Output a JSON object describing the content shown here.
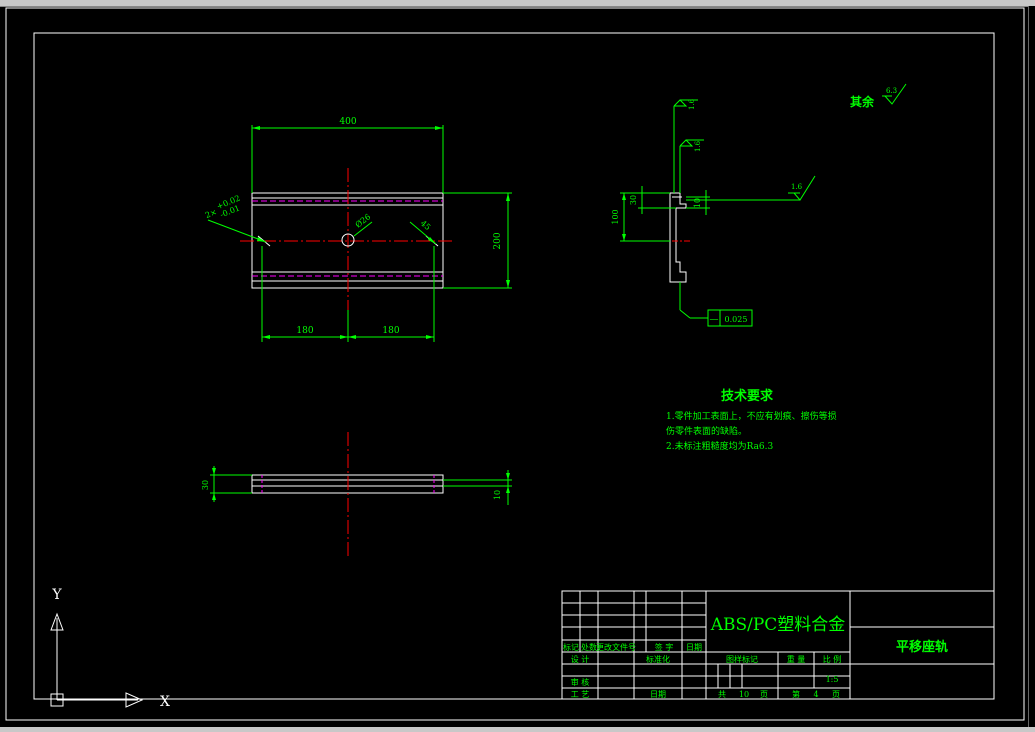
{
  "colors": {
    "background": "#000000",
    "frame": "#ffffff",
    "dimension": "#00ff00",
    "centerline": "#ff0000",
    "hidden": "#ff00ff",
    "ucs": "#ffffff"
  },
  "front_view": {
    "dim_width": "400",
    "dim_height": "200",
    "dim_left_spacing": "180",
    "dim_right_spacing": "180",
    "tol_upper": "+0.02",
    "tol_lower": "-0.01",
    "tol_prefix": "2×",
    "hole_dia": "Ø26",
    "dim_chamfer": "45"
  },
  "bottom_view": {
    "dim_left": "30",
    "dim_right": "10"
  },
  "side_view": {
    "dim_total": "100",
    "dim_slot": "30",
    "dim_thickness": "10",
    "roughness_top": "1.6",
    "roughness_mid": "1.6",
    "roughness_right": "1.6",
    "flatness_symbol": "—",
    "flatness_value": "0.025"
  },
  "remaining_roughness": {
    "label": "其余",
    "value": "6.3"
  },
  "tech_requirements": {
    "title": "技术要求",
    "line1": "1.零件加工表面上，不应有划痕、擦伤等损",
    "line2": "伤零件表面的缺陷。",
    "line3": "2.未标注粗糙度均为Ra6.3"
  },
  "title_block": {
    "material": "ABS/PC塑料合金",
    "part_name": "平移座轨",
    "header_mark": "标记",
    "header_count": "处数",
    "header_doc": "更改文件号",
    "header_sign": "签 字",
    "header_date": "日期",
    "design": "设 计",
    "standardize": "标准化",
    "review": "审 核",
    "process": "工 艺",
    "date": "日期",
    "stage_mark": "图样标记",
    "weight": "重 量",
    "scale_label": "比 例",
    "scale_value": "1:5",
    "total_label": "共",
    "total_value": "10",
    "total_unit": "页",
    "page_label": "第",
    "page_value": "4",
    "page_unit": "页"
  },
  "ucs": {
    "y_label": "Y",
    "x_label": "X"
  }
}
